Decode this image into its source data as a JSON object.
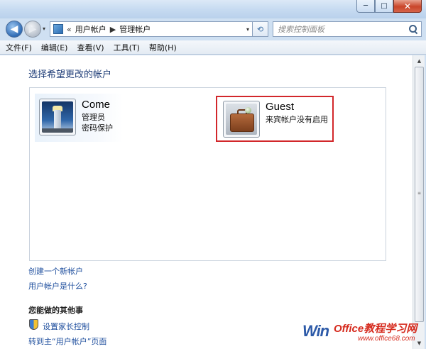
{
  "window": {
    "buttons": {
      "minimize": "─",
      "maximize": "□",
      "close": "✕"
    }
  },
  "nav": {
    "back_icon": "◀",
    "forward_icon": "▶",
    "dropdown_icon": "▾"
  },
  "address": {
    "prefix": "«",
    "crumbs": [
      "用户帐户",
      "管理帐户"
    ],
    "separator": "▶",
    "dropdown_icon": "▾",
    "refresh_icon": "⟲"
  },
  "search": {
    "placeholder": "搜索控制面板"
  },
  "menu": [
    "文件(F)",
    "编辑(E)",
    "查看(V)",
    "工具(T)",
    "帮助(H)"
  ],
  "content": {
    "heading": "选择希望更改的帐户",
    "accounts": [
      {
        "name": "Come",
        "lines": [
          "管理员",
          "密码保护"
        ],
        "avatar": "lighthouse-icon"
      },
      {
        "name": "Guest",
        "lines": [
          "来宾帐户没有启用"
        ],
        "avatar": "briefcase-icon"
      }
    ],
    "links": {
      "create_account": "创建一个新帐户",
      "what_is_account": "用户帐户是什么?"
    },
    "other_section": {
      "title": "您能做的其他事",
      "items": [
        "设置家长控制",
        "转到主“用户帐户”页面"
      ]
    }
  },
  "watermark": {
    "win": "Win",
    "office": "Office教程学习网",
    "url": "www.office68.com"
  },
  "colors": {
    "highlight": "#d2272b",
    "link": "#1f4f9e",
    "heading": "#1f3d77"
  }
}
